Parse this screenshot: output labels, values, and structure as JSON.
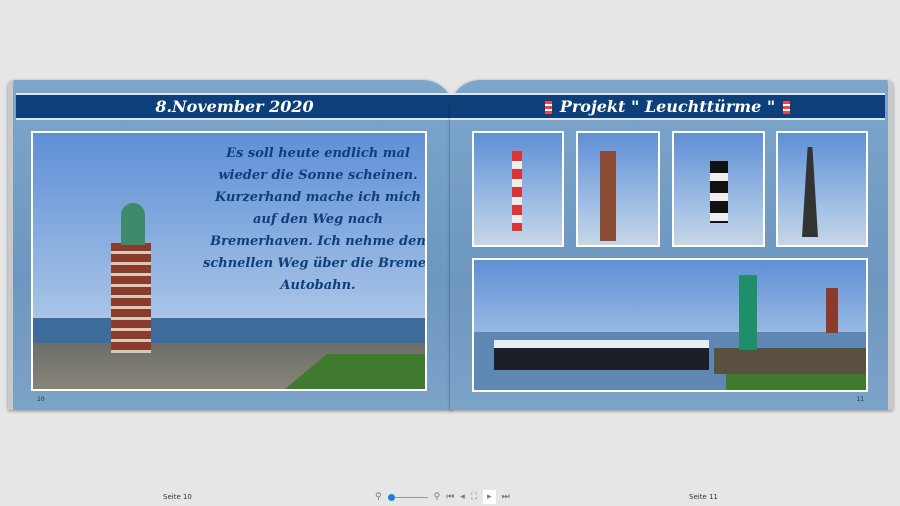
{
  "left_page": {
    "title": "8.November 2020",
    "text": "Es soll heute endlich mal wieder die Sonne scheinen. Kurzerhand mache ich mich auf den Weg nach Bremerhaven. Ich nehme den schnellen Weg über die Bremer Autobahn.",
    "page_number": "10"
  },
  "right_page": {
    "title": "Projekt \" Leuchttürme \"",
    "page_number": "11"
  },
  "footer": {
    "left_label": "Seite 10",
    "right_label": "Seite 11"
  },
  "toolbar": {
    "icons": [
      "zoom-out-icon",
      "zoom-slider",
      "zoom-in-icon",
      "first-page-icon",
      "previous-page-icon",
      "overview-icon",
      "next-page-icon",
      "last-page-icon"
    ],
    "zoom_level": 0.1
  },
  "colors": {
    "header_band": "#0d3f7a",
    "page_bg": "#7da6cc",
    "text": "#0d3f7a"
  }
}
